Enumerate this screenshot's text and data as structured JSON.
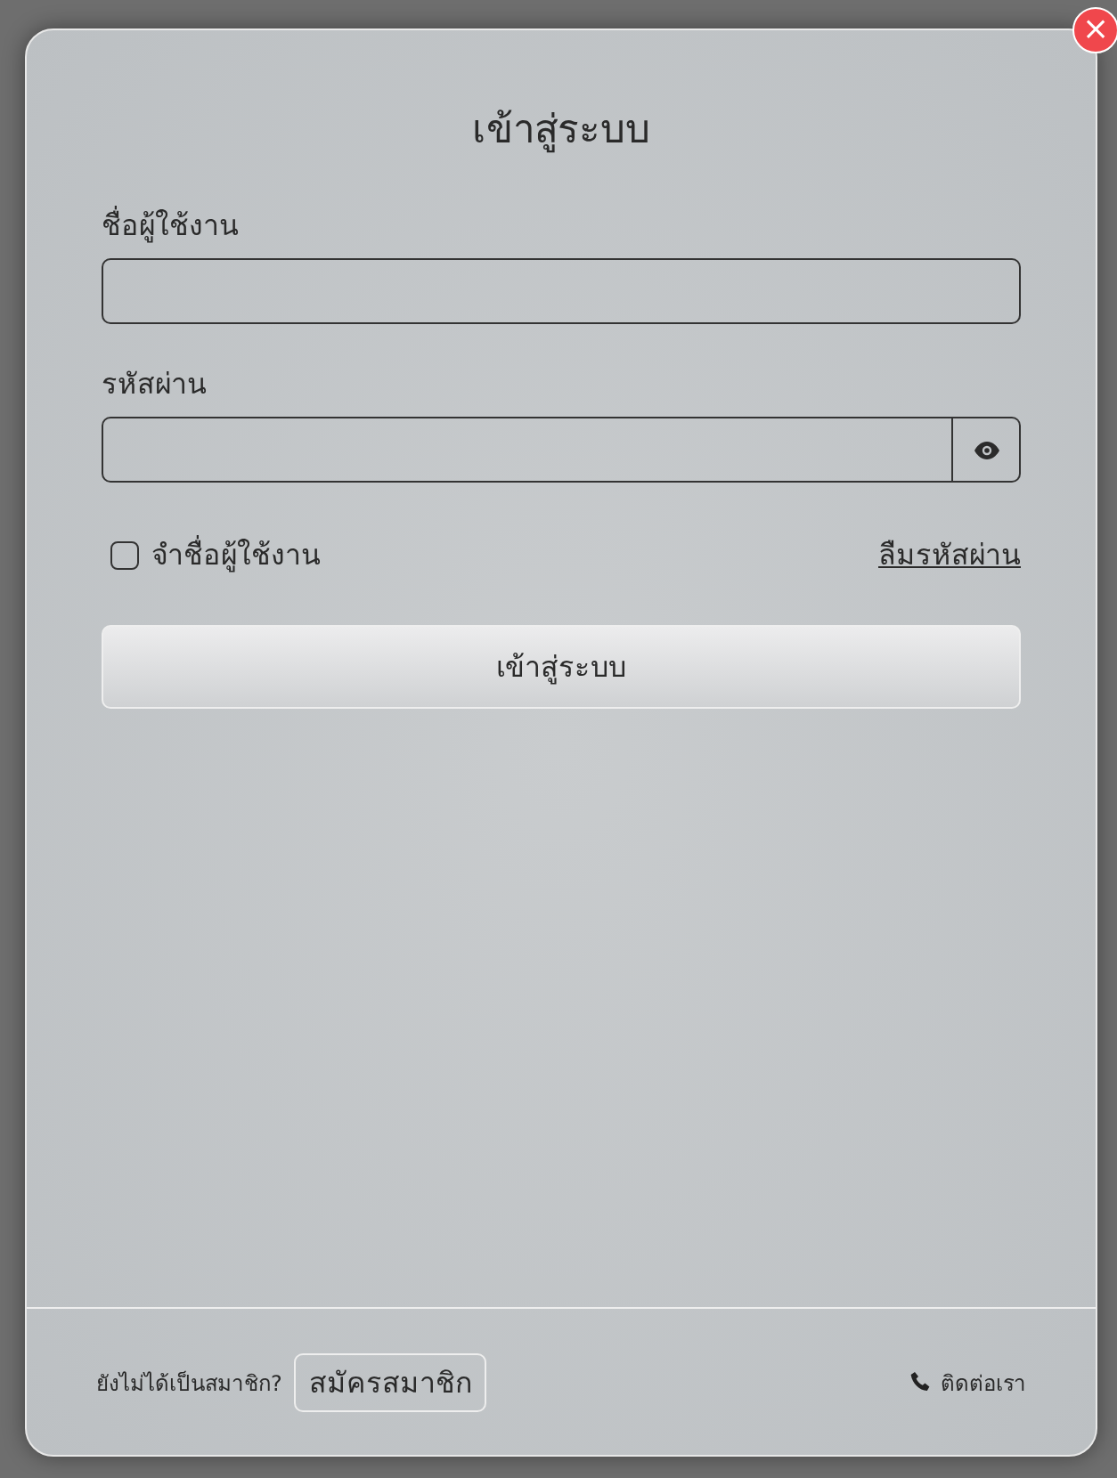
{
  "dialog": {
    "title": "เข้าสู่ระบบ",
    "close": "×"
  },
  "username": {
    "label": "ชื่อผู้ใช้งาน"
  },
  "password": {
    "label": "รหัสผ่าน"
  },
  "remember": {
    "label": "จำชื่อผู้ใช้งาน",
    "checked": false
  },
  "forgot_link": "ลืมรหัสผ่าน",
  "submit": "เข้าสู่ระบบ",
  "footer": {
    "prompt": "ยังไม่ได้เป็นสมาชิก?",
    "register": "สมัครสมาชิก",
    "contact": "ติดต่อเรา"
  }
}
